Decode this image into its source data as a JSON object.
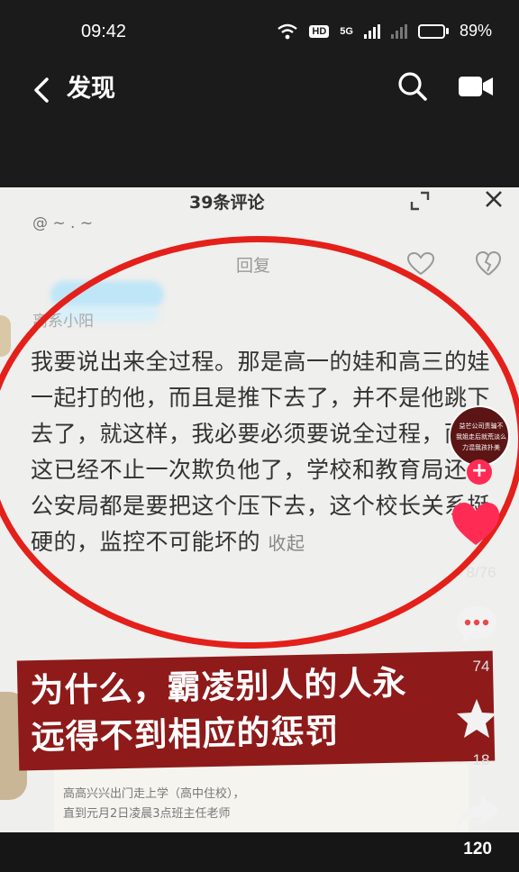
{
  "status_bar": {
    "time": "09:42",
    "hd_label": "HD",
    "network_label": "5G",
    "battery_percent": "89%",
    "battery_level": 0.89
  },
  "nav": {
    "title": "发现",
    "icons": [
      "back-icon",
      "search-icon",
      "camera-icon"
    ]
  },
  "comments_panel": {
    "title": "39条评论",
    "mention": "@ ~ . ~",
    "reply_label": "回复",
    "username": "离系小阳",
    "comment": "我要说出来全过程。那是高一的娃和高三的娃一起打的他，而且是推下去了，并不是他跳下去了，就这样，我必要必须要说全过程，而且这已经不止一次欺负他了，学校和教育局还有公安局都是要把这个压下去，这个校长关系挺硬的，监控不可能坏的",
    "collapse_label": "收起",
    "document_lines": [
      "高高兴兴出门走上学（高中住校），",
      "直到元月2日凌晨3点班主任老师"
    ]
  },
  "caption": {
    "line1": "为什么，霸凌别人的人永",
    "line2": "远得不到相应的惩罚"
  },
  "right_rail": {
    "avatar_text": [
      "益芒公司责骗不",
      "我姐走后就荒淡么",
      "力混我孩扑美"
    ],
    "follow_label": "+",
    "likes": "8/76",
    "comments": "74",
    "favorites": "18",
    "shares": "120"
  },
  "colors": {
    "accent": "#fe2c55",
    "annotation_red": "#e4201a",
    "caption_bg": "#8e1a1a"
  }
}
